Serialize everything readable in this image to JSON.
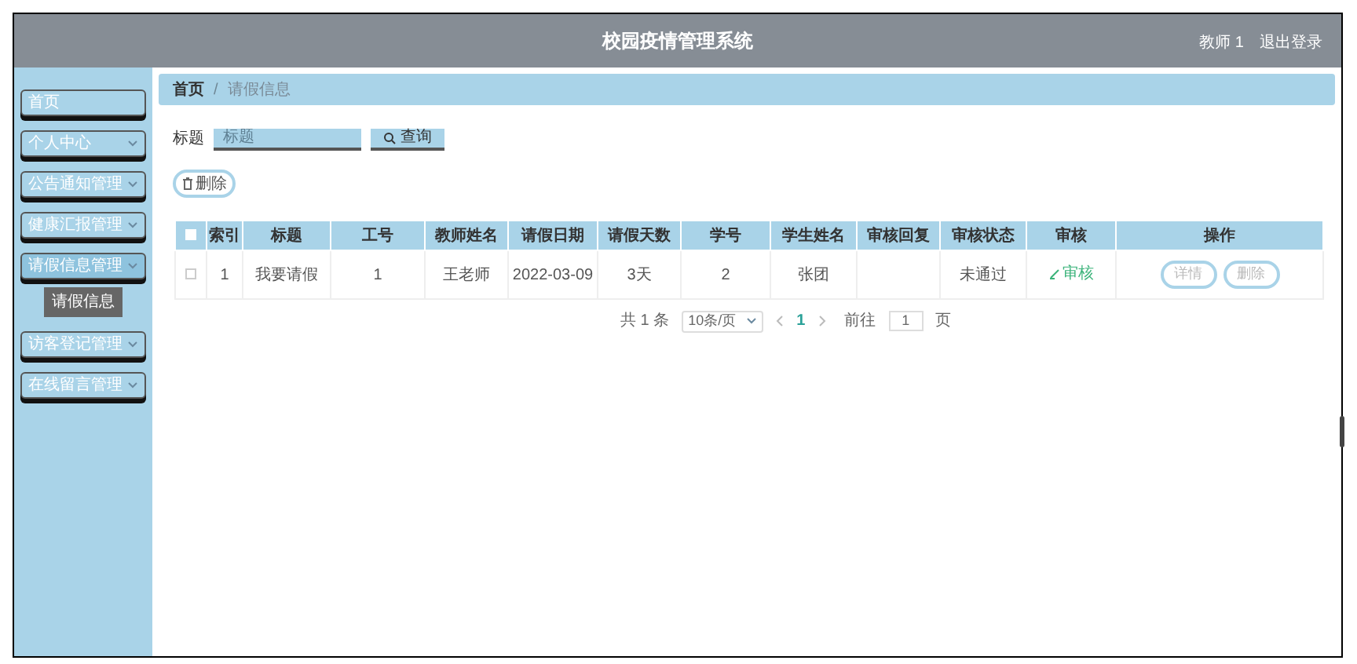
{
  "header": {
    "title": "校园疫情管理系统",
    "user": "教师 1",
    "logout": "退出登录"
  },
  "sidebar": {
    "items": [
      {
        "label": "首页",
        "expandable": false,
        "expanded": false
      },
      {
        "label": "个人中心",
        "expandable": true,
        "expanded": false
      },
      {
        "label": "公告通知管理",
        "expandable": true,
        "expanded": false
      },
      {
        "label": "健康汇报管理",
        "expandable": true,
        "expanded": false
      },
      {
        "label": "请假信息管理",
        "expandable": true,
        "expanded": true,
        "children": [
          {
            "label": "请假信息",
            "selected": true
          }
        ]
      },
      {
        "label": "访客登记管理",
        "expandable": true,
        "expanded": false
      },
      {
        "label": "在线留言管理",
        "expandable": true,
        "expanded": false
      }
    ]
  },
  "breadcrumb": [
    "首页",
    "请假信息"
  ],
  "breadcrumb_separator": "/",
  "search": {
    "label": "标题",
    "placeholder": "标题",
    "button": "查询"
  },
  "delete_button": "删除",
  "table": {
    "all_checked": false,
    "columns": [
      "索引",
      "标题",
      "工号",
      "教师姓名",
      "请假日期",
      "请假天数",
      "学号",
      "学生姓名",
      "审核回复",
      "审核状态",
      "审核",
      "操作"
    ],
    "rows": [
      {
        "checked": false,
        "cells": [
          "1",
          "我要请假",
          "1",
          "王老师",
          "2022-03-09",
          "3天",
          "2",
          "张团",
          "",
          "未通过"
        ],
        "audit": "审核",
        "actions": [
          "详情",
          "删除"
        ]
      }
    ]
  },
  "pagination": {
    "total": "共 1 条",
    "page_size": "10条/页",
    "pages": [
      {
        "label": "1",
        "selected": true
      }
    ],
    "goto": "前往",
    "goto_value": "1",
    "page_unit": "页"
  }
}
